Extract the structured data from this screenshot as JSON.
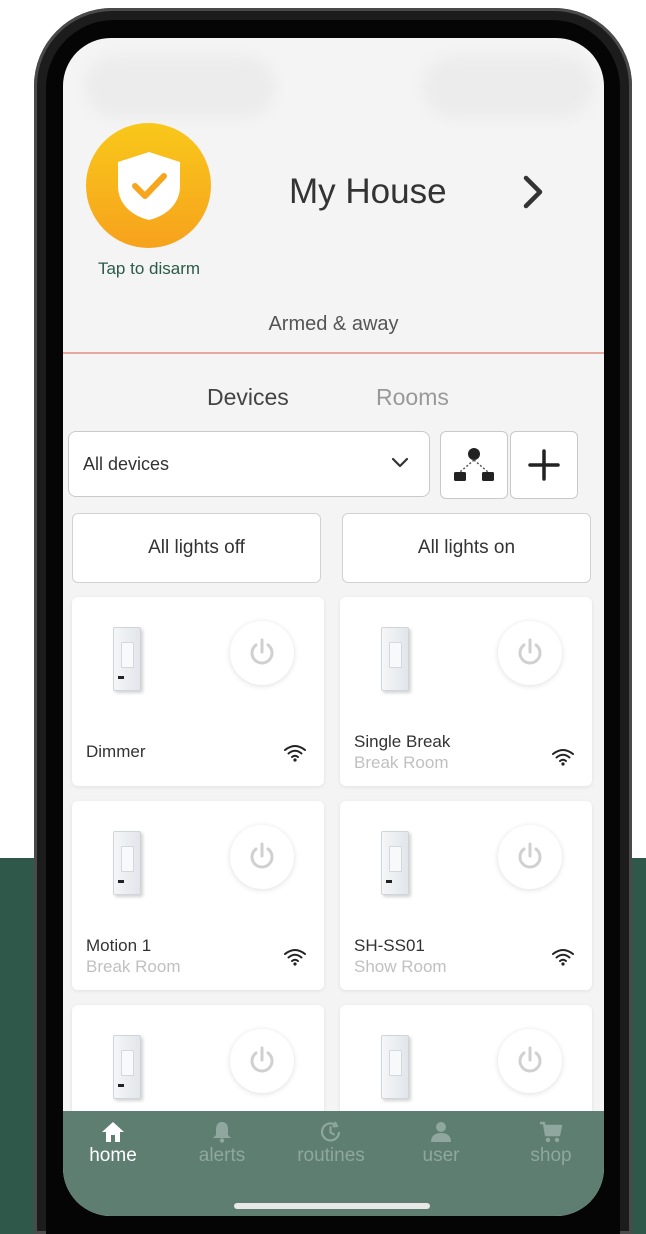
{
  "security": {
    "disarm_label": "Tap to disarm",
    "status": "Armed & away"
  },
  "house": {
    "title": "My House"
  },
  "tabs": [
    {
      "label": "Devices",
      "active": true
    },
    {
      "label": "Rooms",
      "active": false
    }
  ],
  "filter": {
    "selected": "All devices"
  },
  "lights": {
    "off_label": "All lights off",
    "on_label": "All lights on"
  },
  "devices": [
    {
      "name": "Dimmer",
      "room": ""
    },
    {
      "name": "Single Break",
      "room": "Break Room"
    },
    {
      "name": "Motion 1",
      "room": "Break Room"
    },
    {
      "name": "SH-SS01",
      "room": "Show Room"
    },
    {
      "name": "",
      "room": ""
    },
    {
      "name": "",
      "room": ""
    }
  ],
  "nav": {
    "items": [
      {
        "label": "home",
        "icon": "home-icon",
        "active": true
      },
      {
        "label": "alerts",
        "icon": "bell-icon",
        "active": false
      },
      {
        "label": "routines",
        "icon": "clock-icon",
        "active": false
      },
      {
        "label": "user",
        "icon": "user-icon",
        "active": false
      },
      {
        "label": "shop",
        "icon": "cart-icon",
        "active": false
      }
    ]
  },
  "colors": {
    "accent_green": "#5e7e72",
    "background_band": "#30584a",
    "shield_yellow": "#f7b21b",
    "divider": "#e6a79e"
  }
}
